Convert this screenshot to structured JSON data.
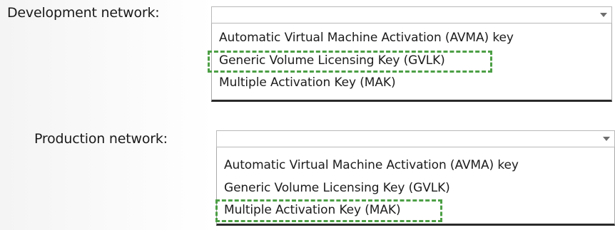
{
  "dev": {
    "label": "Development network:",
    "selected_value": "",
    "options": [
      "Automatic Virtual Machine Activation (AVMA) key",
      "Generic Volume Licensing Key (GVLK)",
      "Multiple Activation Key (MAK)"
    ],
    "highlighted_option": "Generic Volume Licensing Key (GVLK)"
  },
  "prod": {
    "label": "Production network:",
    "selected_value": "",
    "options": [
      "Automatic Virtual Machine Activation (AVMA) key",
      "Generic Volume Licensing Key (GVLK)",
      "Multiple Activation Key (MAK)"
    ],
    "highlighted_option": "Multiple Activation Key (MAK)"
  },
  "icons": {
    "dropdown": "chevron-down-icon"
  },
  "colors": {
    "highlight": "#4c9f45"
  }
}
